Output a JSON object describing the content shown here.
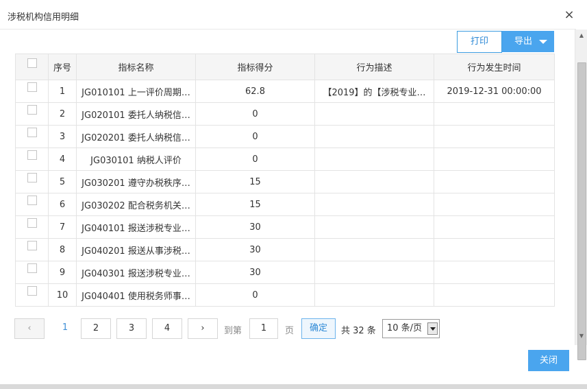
{
  "dialog": {
    "title": "涉税机构信用明细",
    "close_icon": "×"
  },
  "toolbar": {
    "print_label": "打印",
    "export_label": "导出"
  },
  "table": {
    "headers": {
      "index": "序号",
      "name": "指标名称",
      "score": "指标得分",
      "desc": "行为描述",
      "time": "行为发生时间"
    },
    "rows": [
      {
        "index": "1",
        "name": "JG010101 上一评价周期…",
        "score": "62.8",
        "desc": "【2019】的【涉税专业…",
        "time": "2019-12-31 00:00:00"
      },
      {
        "index": "2",
        "name": "JG020101 委托人纳税信…",
        "score": "0",
        "desc": "",
        "time": ""
      },
      {
        "index": "3",
        "name": "JG020201 委托人纳税信…",
        "score": "0",
        "desc": "",
        "time": ""
      },
      {
        "index": "4",
        "name": "JG030101 纳税人评价",
        "score": "0",
        "desc": "",
        "time": ""
      },
      {
        "index": "5",
        "name": "JG030201 遵守办税秩序…",
        "score": "15",
        "desc": "",
        "time": ""
      },
      {
        "index": "6",
        "name": "JG030202 配合税务机关…",
        "score": "15",
        "desc": "",
        "time": ""
      },
      {
        "index": "7",
        "name": "JG040101 报送涉税专业…",
        "score": "30",
        "desc": "",
        "time": ""
      },
      {
        "index": "8",
        "name": "JG040201 报送从事涉税…",
        "score": "30",
        "desc": "",
        "time": ""
      },
      {
        "index": "9",
        "name": "JG040301 报送涉税专业…",
        "score": "30",
        "desc": "",
        "time": ""
      },
      {
        "index": "10",
        "name": "JG040401 使用税务师事…",
        "score": "0",
        "desc": "",
        "time": ""
      }
    ]
  },
  "pagination": {
    "prev_icon": "‹",
    "next_icon": "›",
    "pages": [
      "1",
      "2",
      "3",
      "4"
    ],
    "current_page": "1",
    "goto_label": "到第",
    "goto_value": "1",
    "page_label": "页",
    "confirm_label": "确定",
    "total_label": "共 32 条",
    "page_size": "10 条/页"
  },
  "footer": {
    "close_label": "关闭"
  },
  "colors": {
    "accent": "#4aa5ee",
    "link": "#2f8ad6"
  }
}
